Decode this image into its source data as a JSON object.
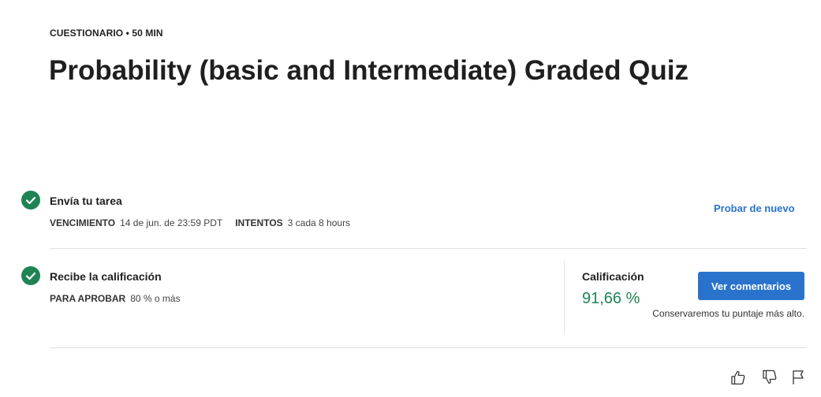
{
  "header": {
    "meta": "CUESTIONARIO • 50 MIN",
    "title": "Probability (basic and Intermediate) Graded Quiz"
  },
  "submit_step": {
    "title": "Envía tu tarea",
    "due_label": "VENCIMIENTO",
    "due_value": "14 de jun. de 23:59 PDT",
    "attempts_label": "INTENTOS",
    "attempts_value": "3 cada 8 hours",
    "retry_label": "Probar de nuevo"
  },
  "grade_step": {
    "title": "Recibe la calificación",
    "pass_label": "PARA APROBAR",
    "pass_value": "80 % o más",
    "grade_label": "Calificación",
    "grade_value": "91,66 %",
    "feedback_button": "Ver comentarios",
    "keep_note": "Conservaremos tu puntaje más alto."
  },
  "footer": {
    "icons": [
      "thumbs-up-icon",
      "thumbs-down-icon",
      "flag-icon"
    ]
  },
  "colors": {
    "accent": "#2a73cc",
    "success": "#1f8354"
  }
}
